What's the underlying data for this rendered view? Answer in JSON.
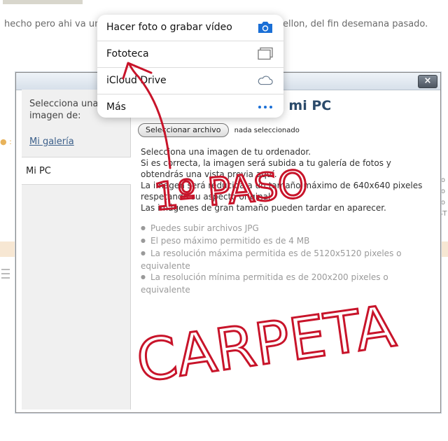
{
  "background": {
    "text_left": "hecho pero ahi va una",
    "text_right": "ellon,  del fin desemana pasado."
  },
  "modal": {
    "close_label": "×",
    "sidebar": {
      "heading": "Selecciona una imagen de:",
      "gallery_link": "Mi galería",
      "active_item": "Mi PC"
    },
    "title": "sde mi PC",
    "file_button": "Seleccionar archivo",
    "file_status": "nada seleccionado",
    "description": [
      "Selecciona una imagen de tu ordenador.",
      "Si es correcta, la imagen será subida a tu galería de fotos y obtendrás una vista previa aquí.",
      "La imagen será reducida a un tamaño máximo de 640x640 pixeles respetando su aspecto original.",
      "Las imágenes de gran tamaño pueden tardar en aparecer."
    ],
    "rules": [
      "Puedes subir archivos JPG",
      "El peso máximo permitido es de 4 MB",
      "La resolución máxima permitida es de 5120x5120 pixeles o equivalente",
      "La resolución mínima permitida es de 200x200 pixeles o equivalente"
    ]
  },
  "action_sheet": {
    "items": [
      {
        "label": "Hacer foto o grabar vídeo",
        "icon": "camera-icon"
      },
      {
        "label": "Fototeca",
        "icon": "photo-library-icon"
      },
      {
        "label": "iCloud Drive",
        "icon": "cloud-icon"
      },
      {
        "label": "Más",
        "icon": "more-icon"
      }
    ],
    "accent_color": "#1a6fd6"
  },
  "annotation": {
    "line1": "1º PASO",
    "line2": "CARPETA",
    "color": "#c8142a"
  }
}
